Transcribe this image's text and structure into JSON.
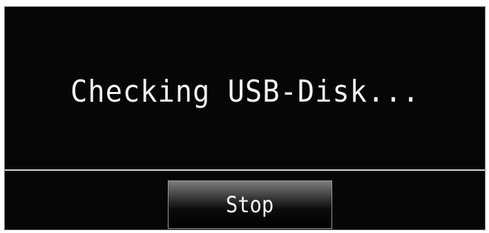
{
  "dialog": {
    "message": "Checking USB-Disk...",
    "stop_label": "Stop"
  },
  "colors": {
    "background": "#060606",
    "text": "#f2f2f2",
    "divider": "#d8d8d8",
    "button_border": "#9a9a9a"
  }
}
